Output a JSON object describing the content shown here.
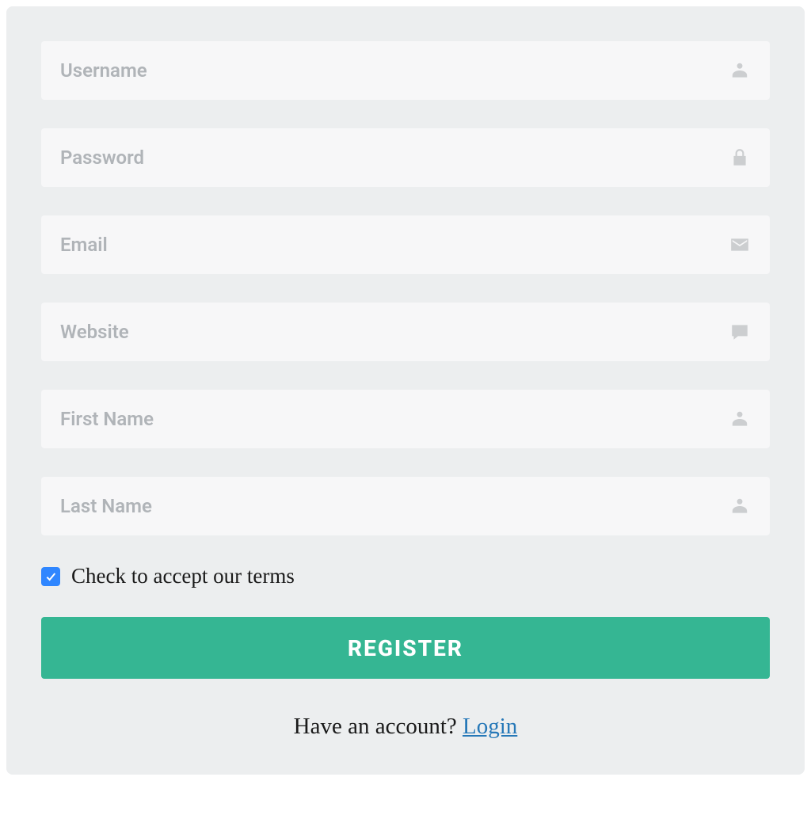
{
  "form": {
    "fields": {
      "username": {
        "placeholder": "Username",
        "value": ""
      },
      "password": {
        "placeholder": "Password",
        "value": ""
      },
      "email": {
        "placeholder": "Email",
        "value": ""
      },
      "website": {
        "placeholder": "Website",
        "value": ""
      },
      "first_name": {
        "placeholder": "First Name",
        "value": ""
      },
      "last_name": {
        "placeholder": "Last Name",
        "value": ""
      }
    },
    "terms": {
      "label": "Check to accept our terms",
      "checked": true
    },
    "submit_label": "REGISTER",
    "footer": {
      "text": "Have an account? ",
      "link_label": "Login"
    }
  },
  "colors": {
    "accent": "#35b693",
    "checkbox": "#2f86ff",
    "link": "#2678b8"
  }
}
